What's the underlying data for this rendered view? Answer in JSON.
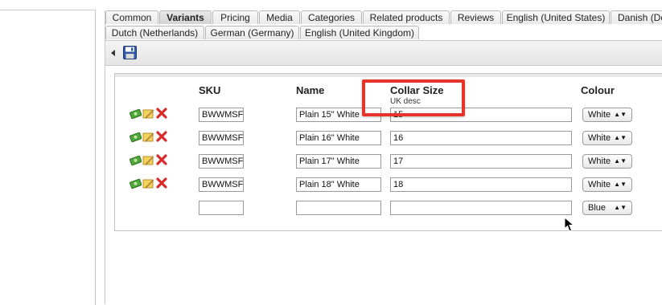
{
  "tabs_row1": [
    {
      "label": "Common",
      "active": false
    },
    {
      "label": "Variants",
      "active": true
    },
    {
      "label": "Pricing",
      "active": false
    },
    {
      "label": "Media",
      "active": false
    },
    {
      "label": "Categories",
      "active": false
    },
    {
      "label": "Related products",
      "active": false
    },
    {
      "label": "Reviews",
      "active": false
    },
    {
      "label": "English (United States)",
      "active": false
    },
    {
      "label": "Danish (De",
      "active": false
    }
  ],
  "tabs_row2": [
    {
      "label": "Dutch (Netherlands)",
      "active": false
    },
    {
      "label": "German (Germany)",
      "active": false
    },
    {
      "label": "English (United Kingdom)",
      "active": false
    }
  ],
  "toolbar": {
    "back_icon": "triangle-left-icon",
    "save_icon": "floppy-disk-icon"
  },
  "grid": {
    "headers": {
      "sku": "SKU",
      "name": "Name",
      "collar_size": "Collar Size",
      "collar_size_sub": "UK desc",
      "colour": "Colour"
    },
    "rows": [
      {
        "sku": "BWWMSFS",
        "name": "Plain 15\" White",
        "collar": "15",
        "colour": "White"
      },
      {
        "sku": "BWWMSFS",
        "name": "Plain 16\" White",
        "collar": "16",
        "colour": "White"
      },
      {
        "sku": "BWWMSFS",
        "name": "Plain 17\" White",
        "collar": "17",
        "colour": "White"
      },
      {
        "sku": "BWWMSFS",
        "name": "Plain 18\" White",
        "collar": "18",
        "colour": "White"
      }
    ],
    "new_row": {
      "sku": "",
      "name": "",
      "collar": "",
      "colour": "Blue"
    }
  },
  "colors": {
    "highlight": "#e5352b",
    "tab_active_bg": "#d3d3d3"
  }
}
